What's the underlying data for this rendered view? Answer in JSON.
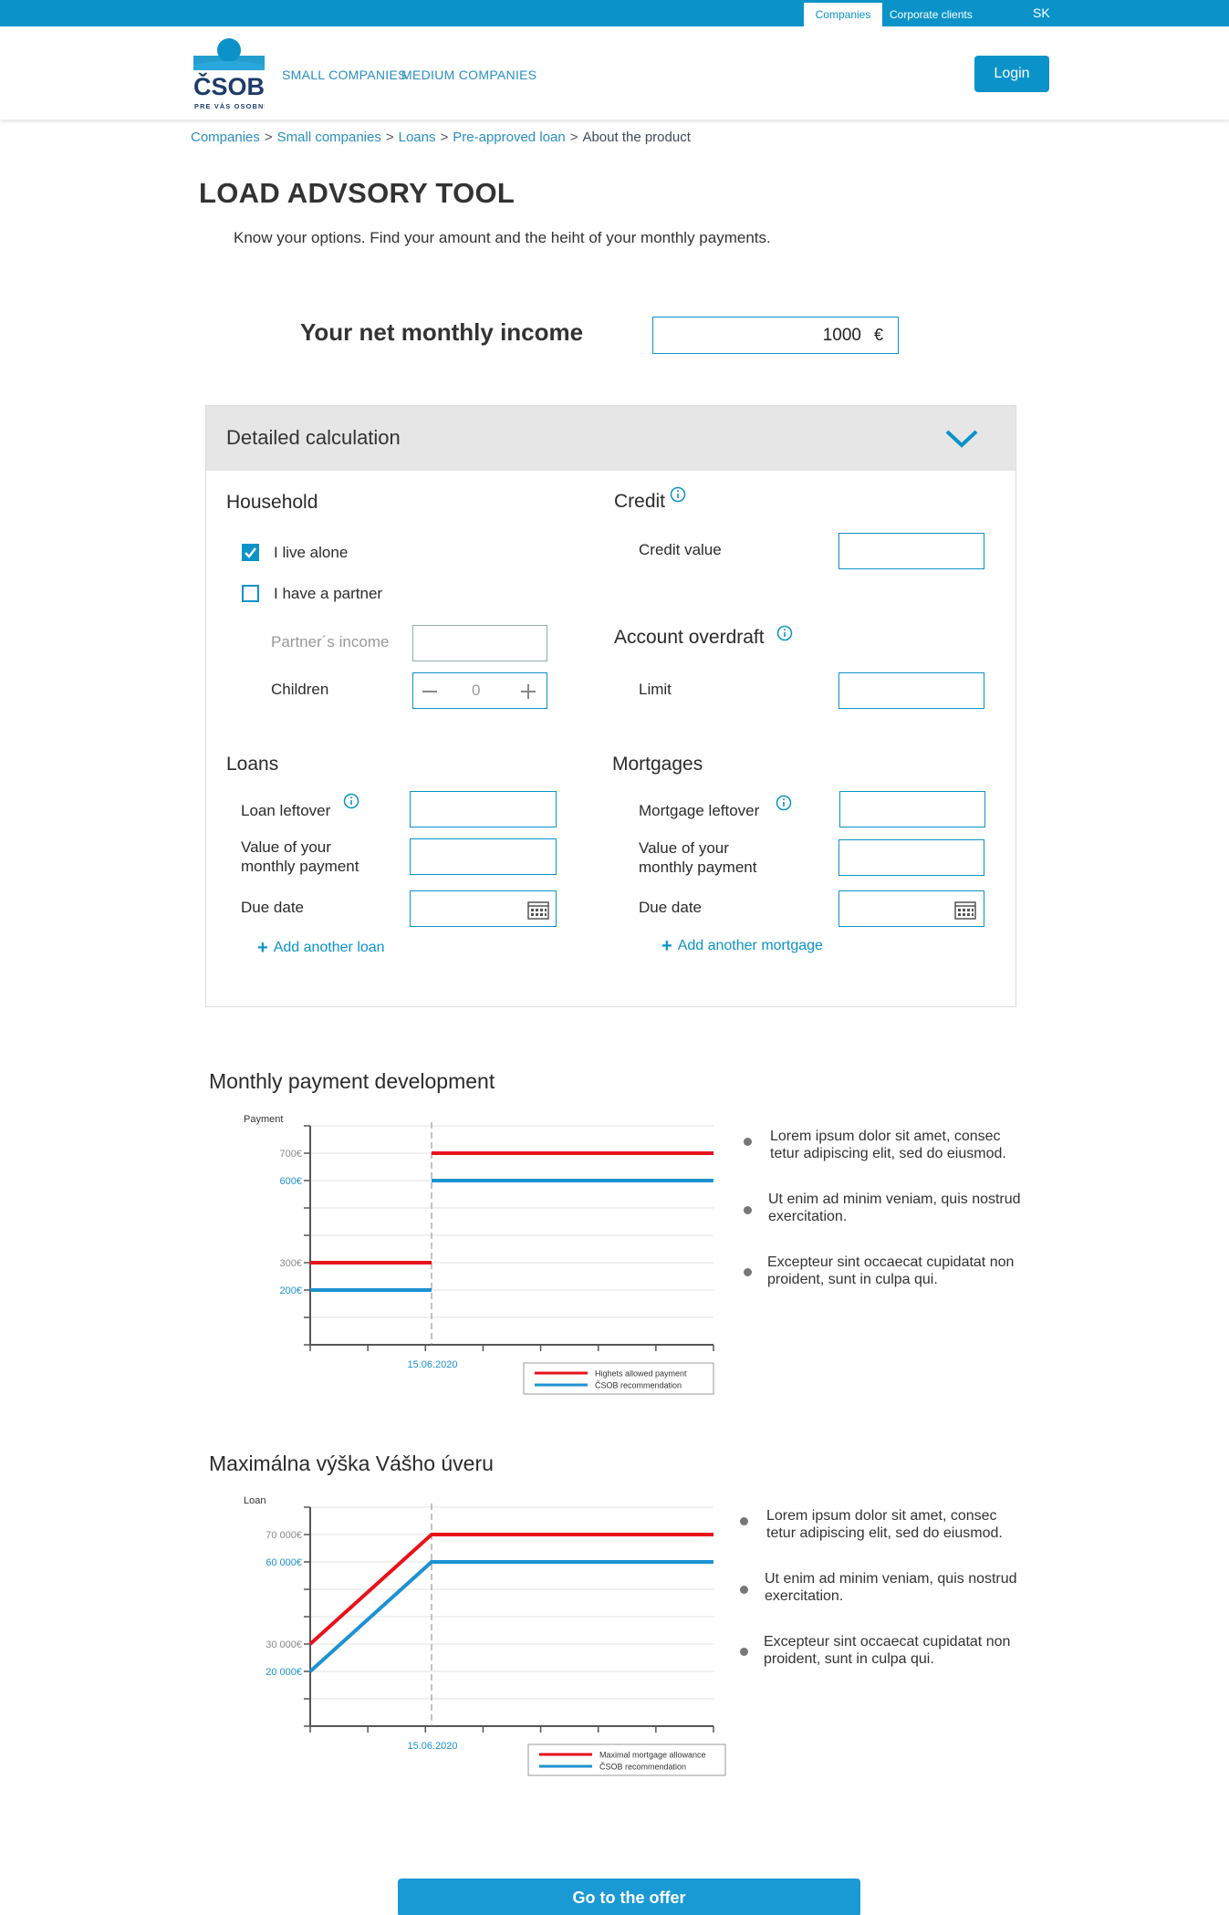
{
  "topbar": {
    "tab_active": "Companies",
    "tab_other": "Corporate clients",
    "lang": "SK"
  },
  "header": {
    "logo_text": "ČSOB",
    "logo_sub": "PRE VÁS OSOBNE",
    "nav": [
      "SMALL COMPANIES",
      "MEDIUM COMPANIES"
    ],
    "login": "Login"
  },
  "breadcrumb": [
    "Companies",
    "Small companies",
    "Loans",
    "Pre-approved loan",
    "About the product"
  ],
  "page": {
    "title": "LOAD ADVSORY TOOL",
    "subtitle": "Know your options. Find your amount and the heiht of your monthly payments."
  },
  "income": {
    "label": "Your net monthly income",
    "value": "1000",
    "unit": "€"
  },
  "detail": {
    "title": "Detailed calculation",
    "household": {
      "title": "Household",
      "live_alone": "I live alone",
      "partner": "I have a partner",
      "partner_income": "Partner´s income",
      "children": "Children",
      "children_value": "0"
    },
    "credit": {
      "title": "Credit",
      "value_label": "Credit value"
    },
    "overdraft": {
      "title": "Account overdraft",
      "limit_label": "Limit"
    },
    "loans": {
      "title": "Loans",
      "leftover": "Loan leftover",
      "monthly_1": "Value of your",
      "monthly_2": "monthly payment",
      "due": "Due date",
      "add": "Add another loan"
    },
    "mortgages": {
      "title": "Mortgages",
      "leftover": "Mortgage leftover",
      "monthly_1": "Value of your",
      "monthly_2": "monthly payment",
      "due": "Due date",
      "add": "Add another mortgage"
    }
  },
  "chart1": {
    "title": "Monthly payment development",
    "bullets": [
      [
        "Lorem ipsum dolor sit amet, consec",
        "tetur adipiscing elit, sed do eiusmod."
      ],
      [
        "Ut enim ad minim veniam, quis nostrud",
        "exercitation."
      ],
      [
        "Excepteur sint occaecat cupidatat non",
        "proident, sunt in culpa qui."
      ]
    ]
  },
  "chart2": {
    "title": "Maximálna výška Vášho úveru",
    "bullets": [
      [
        "Lorem ipsum dolor sit amet, consec",
        "tetur adipiscing elit, sed do eiusmod."
      ],
      [
        "Ut enim ad minim veniam, quis nostrud",
        "exercitation."
      ],
      [
        "Excepteur sint occaecat cupidatat non",
        "proident, sunt in culpa qui."
      ]
    ]
  },
  "chart_data": [
    {
      "type": "line",
      "title": "Monthly payment development",
      "ylabel": "Payment",
      "yticks": [
        "700€",
        "600€",
        "300€",
        "200€"
      ],
      "xticks": [
        "15.06.2020"
      ],
      "series": [
        {
          "name": "Highets allowed payment",
          "color": "#e8121c",
          "before": 300,
          "after": 700
        },
        {
          "name": "ČSOB recommendation",
          "color": "#1c92d2",
          "before": 200,
          "after": 600
        }
      ],
      "legend": "bottom-right"
    },
    {
      "type": "line",
      "title": "Maximálna výška Vášho úveru",
      "ylabel": "Loan",
      "yticks": [
        "70 000€",
        "60 000€",
        "30 000€",
        "20 000€"
      ],
      "xticks": [
        "15.06.2020"
      ],
      "series": [
        {
          "name": "Maximal mortgage allowance",
          "color": "#e8121c",
          "start": 30000,
          "end": 70000
        },
        {
          "name": "ČSOB recommendation",
          "color": "#1c92d2",
          "start": 20000,
          "end": 60000
        }
      ],
      "legend": "bottom-right"
    }
  ],
  "cta": "Go to the offer"
}
